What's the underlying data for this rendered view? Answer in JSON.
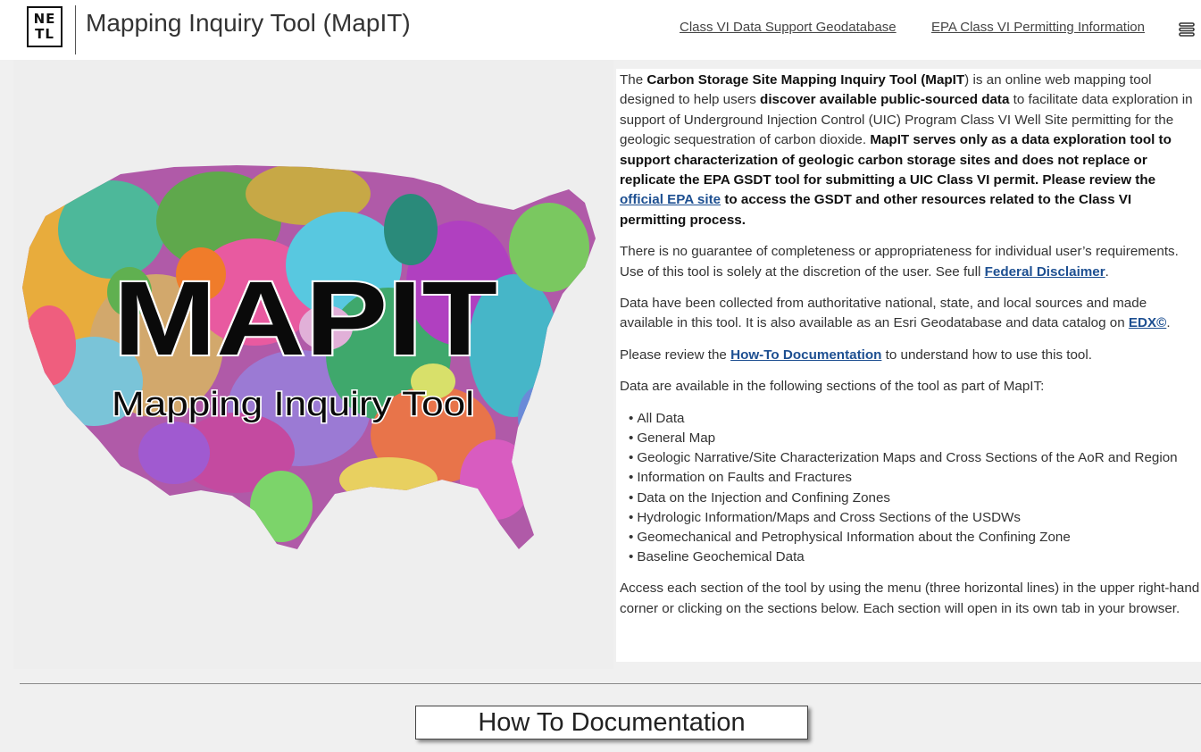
{
  "header": {
    "logo": {
      "line1": "NE",
      "line2": "TL"
    },
    "title": "Mapping Inquiry Tool (MapIT)",
    "links": [
      {
        "label": "Class VI Data Support Geodatabase"
      },
      {
        "label": "EPA Class VI Permitting Information"
      }
    ],
    "menu_icon": "menu-icon"
  },
  "hero": {
    "logo_big": "MAPIT",
    "logo_subtitle": "Mapping Inquiry Tool"
  },
  "intro": {
    "p1": {
      "t1": "The ",
      "b1": "Carbon Storage Site Mapping Inquiry Tool (MapIT",
      "t2": ") is an online web mapping tool designed to help users ",
      "b2": "discover available public-sourced data",
      "t3": " to facilitate data exploration in support of Underground Injection Control (UIC) Program Class VI Well Site permitting for the geologic sequestration of carbon dioxide. ",
      "b3": "MapIT serves only as a data exploration tool to support characterization of geologic carbon storage sites and does not replace or replicate the EPA GSDT tool for submitting a UIC Class VI permit. Please review the ",
      "link": "official EPA site",
      "b4": " to access the GSDT and other resources related to the Class VI permitting process."
    },
    "p2": {
      "t1": "There is no guarantee of completeness or appropriateness for individual user’s requirements.  Use of this tool is solely at the discretion of the user. See full ",
      "link": "Federal Disclaimer",
      "t2": "."
    },
    "p3": {
      "t1": "Data have been collected from authoritative national, state, and local sources and made available in this tool. It is also available as an Esri Geodatabase and data catalog on ",
      "link": "EDX©",
      "t2": "."
    },
    "p4": {
      "t1": "Please review the ",
      "link": "How-To Documentation",
      "t2": " to understand how to use this tool."
    },
    "p5": "Data are available in the following sections of the tool as part of MapIT:",
    "sections": [
      "All Data",
      "General Map",
      "Geologic Narrative/Site Characterization Maps and Cross Sections of the AoR and Region",
      "Information on Faults and Fractures",
      "Data on the Injection and Confining Zones",
      "Hydrologic Information/Maps and Cross Sections of the USDWs",
      "Geomechanical and Petrophysical Information about the Confining Zone",
      "Baseline Geochemical Data"
    ],
    "p6": "Access each section of the tool by using the menu (three horizontal lines) in the upper right-hand corner or clicking on the sections below. Each section will open in its own tab in your browser."
  },
  "howto_button": "How To Documentation"
}
